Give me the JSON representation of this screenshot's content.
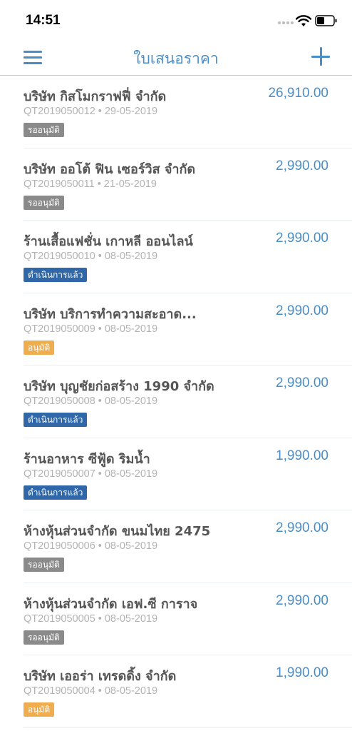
{
  "status_bar": {
    "time": "14:51"
  },
  "nav": {
    "title": "ใบเสนอราคา"
  },
  "colors": {
    "accent": "#4a8ec8",
    "badge_pending": "#8a8a8a",
    "badge_processed": "#2f67a8",
    "badge_approved": "#f0ad4e"
  },
  "quotes": [
    {
      "company": "บริษัท กิสโมกราฟฟี่ จำกัด",
      "number": "QT2019050012",
      "date": "29-05-2019",
      "amount": "26,910.00",
      "status": "รออนุมัติ",
      "status_key": "pending"
    },
    {
      "company": "บริษัท ออโต้ ฟิน เซอร์วิส จำกัด",
      "number": "QT2019050011",
      "date": "21-05-2019",
      "amount": "2,990.00",
      "status": "รออนุมัติ",
      "status_key": "pending"
    },
    {
      "company": "ร้านเสื้อแฟชั่น เกาหลี ออนไลน์",
      "number": "QT2019050010",
      "date": "08-05-2019",
      "amount": "2,990.00",
      "status": "ดำเนินการแล้ว",
      "status_key": "processed"
    },
    {
      "company": "บริษัท บริการทำความสะอาด...",
      "number": "QT2019050009",
      "date": "08-05-2019",
      "amount": "2,990.00",
      "status": "อนุมัติ",
      "status_key": "approved"
    },
    {
      "company": "บริษัท บุญชัยก่อสร้าง 1990 จำกัด",
      "number": "QT2019050008",
      "date": "08-05-2019",
      "amount": "2,990.00",
      "status": "ดำเนินการแล้ว",
      "status_key": "processed"
    },
    {
      "company": "ร้านอาหาร ซีฟู้ด ริมน้ำ",
      "number": "QT2019050007",
      "date": "08-05-2019",
      "amount": "1,990.00",
      "status": "ดำเนินการแล้ว",
      "status_key": "processed"
    },
    {
      "company": "ห้างหุ้นส่วนจำกัด ขนมไทย 2475",
      "number": "QT2019050006",
      "date": "08-05-2019",
      "amount": "2,990.00",
      "status": "รออนุมัติ",
      "status_key": "pending"
    },
    {
      "company": "ห้างหุ้นส่วนจำกัด เอฟ.ซี การาจ",
      "number": "QT2019050005",
      "date": "08-05-2019",
      "amount": "2,990.00",
      "status": "รออนุมัติ",
      "status_key": "pending"
    },
    {
      "company": "บริษัท เออร่า เทรดดิ้ง จำกัด",
      "number": "QT2019050004",
      "date": "08-05-2019",
      "amount": "1,990.00",
      "status": "อนุมัติ",
      "status_key": "approved"
    }
  ]
}
